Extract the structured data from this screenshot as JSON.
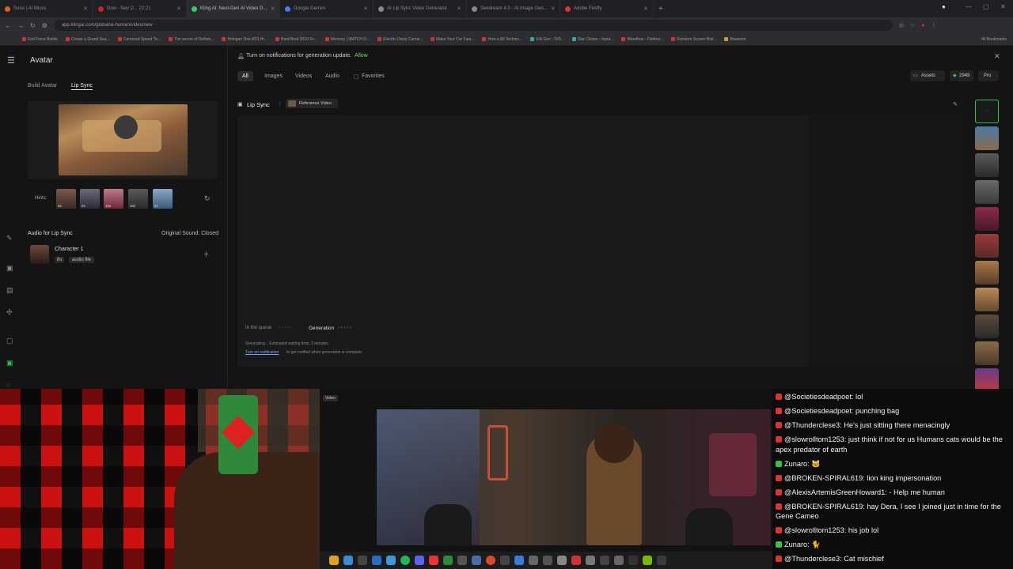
{
  "browser": {
    "tabs": [
      {
        "label": "Suno | AI Music",
        "color": "#e06020"
      },
      {
        "label": "Dow - Nov D... 22:21",
        "color": "#cc2222"
      },
      {
        "label": "Kling AI: Next-Gen AI Video G...",
        "color": "#33cc66",
        "active": true
      },
      {
        "label": "Google Gemini",
        "color": "#4a7cf0"
      },
      {
        "label": "AI Lip Sync Video Generator",
        "color": "#888888"
      },
      {
        "label": "Seedream 4.0 - AI Image Gen...",
        "color": "#888888"
      },
      {
        "label": "Adobe Firefly",
        "color": "#e03030"
      }
    ],
    "url": "app.klingai.com/global/ai-human/video/new",
    "bookmarks": [
      "Esd Force Builds",
      "Create a Grand Sea...",
      "Cornered Speed Te...",
      "The secret of Definin...",
      "Hologan One ATS Hi...",
      "Hard Boot 2019 Sc...",
      "Memory | WATCH D...",
      "Electric Daisy Carniv...",
      "Make Your Car Fast...",
      "How a $6 Technic...",
      "Silk Gen - D/S...",
      "Star Citizen - Input...",
      "Wandbox - Fishbur...",
      "Random Screen Buil...",
      "Braavnet",
      "All Bookmarks"
    ]
  },
  "app": {
    "title": "Avatar",
    "notification": {
      "text": "Turn on notifications for generation update.",
      "action": "Allow"
    },
    "filters": [
      "All",
      "Images",
      "Videos",
      "Audio"
    ],
    "favorites_label": "Favorites",
    "assets_label": "Assets",
    "credits": "2949",
    "plan": "Pro",
    "sidebar_tabs": [
      "Build Avatar",
      "Lip Sync"
    ],
    "hints_label": "Hints:",
    "hint_durations": [
      "5s",
      "8s",
      "10s",
      "10s",
      "5s"
    ],
    "audio_section_title": "Audio for Lip Sync",
    "original_sound": "Original Sound: Closed",
    "character": {
      "name": "Character 1",
      "duration": "8s",
      "type": "audio file"
    },
    "panel_title": "Lip Sync",
    "reference_video_label": "Reference Video",
    "queue": {
      "step1": "In the queue",
      "step2": "Generation"
    },
    "status_line1": "Generating... Estimated waiting time: 2 minutes",
    "status_line2_link": "Turn on notification",
    "status_line2_rest": "to get notified when generation is complete.",
    "lower_label": "Video"
  },
  "chat": {
    "messages": [
      {
        "user": "@Societiesdeadpoet:",
        "text": "lol",
        "platform": "youtube"
      },
      {
        "user": "@Societiesdeadpoet:",
        "text": "punching bag",
        "platform": "youtube"
      },
      {
        "user": "@Thunderclese3:",
        "text": "He's just sitting there menacingly",
        "platform": "youtube"
      },
      {
        "user": "@slowrolltom1253:",
        "text": "just think if not for us Humans cats would be the apex predator of earth",
        "platform": "youtube"
      },
      {
        "user": "Zunaro:",
        "text": "🐱",
        "platform": "kick"
      },
      {
        "user": "@BROKEN-SPIRAL619:",
        "text": "lion king impersonation",
        "platform": "youtube"
      },
      {
        "user": "@AlexisArtemisGreenHoward1:",
        "text": "- Help me human",
        "platform": "youtube"
      },
      {
        "user": "@BROKEN-SPIRAL619:",
        "text": "hay Dera, I see I joined just in time for the Gene Cameo",
        "platform": "youtube"
      },
      {
        "user": "@slowrolltom1253:",
        "text": "his job lol",
        "platform": "youtube"
      },
      {
        "user": "Zunaro:",
        "text": "🐈",
        "platform": "kick"
      },
      {
        "user": "@Thunderclese3:",
        "text": "Cat mischief",
        "platform": "youtube"
      }
    ]
  },
  "colors": {
    "accent_green": "#35c24a",
    "link": "#6fa8ff",
    "allow": "#7fd06f"
  }
}
